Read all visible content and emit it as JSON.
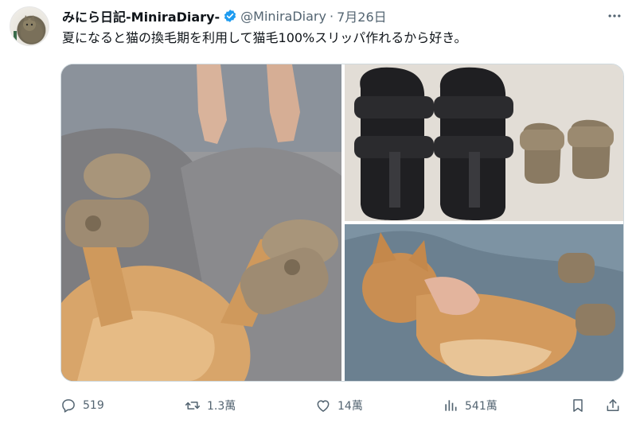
{
  "tweet": {
    "display_name": "みにら日記-MiniraDiary-",
    "handle": "@MiniraDiary",
    "separator": "·",
    "date": "7月26日",
    "text": "夏になると猫の換毛期を利用して猫毛100%スリッパ作れるから好き。"
  },
  "icons": {
    "verified": "verified-badge-icon",
    "more": "more-options-icon",
    "reply": "reply-icon",
    "retweet": "retweet-icon",
    "like": "heart-icon",
    "views": "views-chart-icon",
    "bookmark": "bookmark-icon",
    "share": "share-icon"
  },
  "media": {
    "photos": [
      {
        "name": "cat-lying-on-lap-wearing-fur-slippers"
      },
      {
        "name": "black-sandals-next-to-small-cat-fur-slippers"
      },
      {
        "name": "cat-on-blue-blanket-wearing-fur-slippers"
      }
    ]
  },
  "actions": {
    "reply_count": "519",
    "retweet_count": "1.3萬",
    "like_count": "14萬",
    "views_count": "541萬"
  },
  "colors": {
    "text_primary": "#0f1419",
    "text_secondary": "#536471",
    "verified_blue": "#1d9bf0",
    "border": "#cfd9de"
  }
}
